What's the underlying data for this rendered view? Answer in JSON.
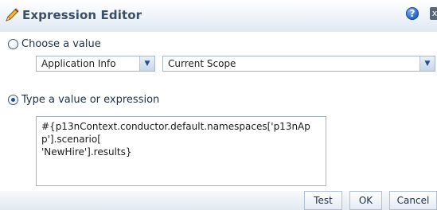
{
  "dialog": {
    "title": "Expression Editor",
    "help_glyph": "?",
    "close_glyph": "x",
    "icons": [
      "pencil-icon",
      "help-icon",
      "close-icon"
    ]
  },
  "choose_value": {
    "label": "Choose a value",
    "selected": false,
    "dropdowns": [
      {
        "value": "Application Info"
      },
      {
        "value": "Current Scope"
      }
    ]
  },
  "expression": {
    "label": "Type a value or expression",
    "selected": true,
    "value": "#{p13nContext.conductor.default.namespaces['p13nApp'].scenario[\n'NewHire'].results}"
  },
  "buttons": {
    "test": "Test",
    "ok": "OK",
    "cancel": "Cancel"
  },
  "colors": {
    "title": "#3a4e66",
    "accent": "#2c4f86",
    "border": "#a7b5c8"
  }
}
